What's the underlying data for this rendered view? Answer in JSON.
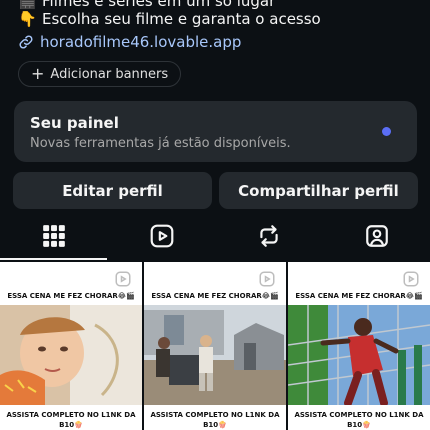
{
  "bio": {
    "line1_icon": "clapper-icon",
    "line1": "Filmes e séries em um só lugar",
    "line2_emoji": "👇",
    "line2": "Escolha seu filme e garanta o acesso",
    "link": "horadofilme46.lovable.app",
    "link_icon": "link-icon"
  },
  "banner_button": {
    "label": "Adicionar banners",
    "icon": "plus-icon"
  },
  "panel": {
    "title": "Seu painel",
    "subtitle": "Novas ferramentas já estão disponíveis.",
    "dot_color": "#5b6ef5"
  },
  "actions": {
    "edit": "Editar perfil",
    "share": "Compartilhar perfil"
  },
  "tabs": [
    {
      "name": "grid-icon",
      "active": true
    },
    {
      "name": "reels-icon",
      "active": false
    },
    {
      "name": "reposts-icon",
      "active": false
    },
    {
      "name": "tagged-icon",
      "active": false
    }
  ],
  "posts": [
    {
      "caption_top": "ESSA CENA ME FEZ CHORAR😂🎬",
      "caption_bottom": "ASSISTA COMPLETO NO L1NK DA B10🍿"
    },
    {
      "caption_top": "ESSA CENA ME FEZ CHORAR😂🎬",
      "caption_bottom": "ASSISTA COMPLETO NO L1NK DA B10🍿"
    },
    {
      "caption_top": "ESSA CENA ME FEZ CHORAR😂🎬",
      "caption_bottom": "ASSISTA COMPLETO NO L1NK DA B10🍿"
    }
  ],
  "colors": {
    "background": "#0c1014",
    "card": "#24292e",
    "link": "#a8c7fa",
    "accent_dot": "#5b6ef5"
  }
}
